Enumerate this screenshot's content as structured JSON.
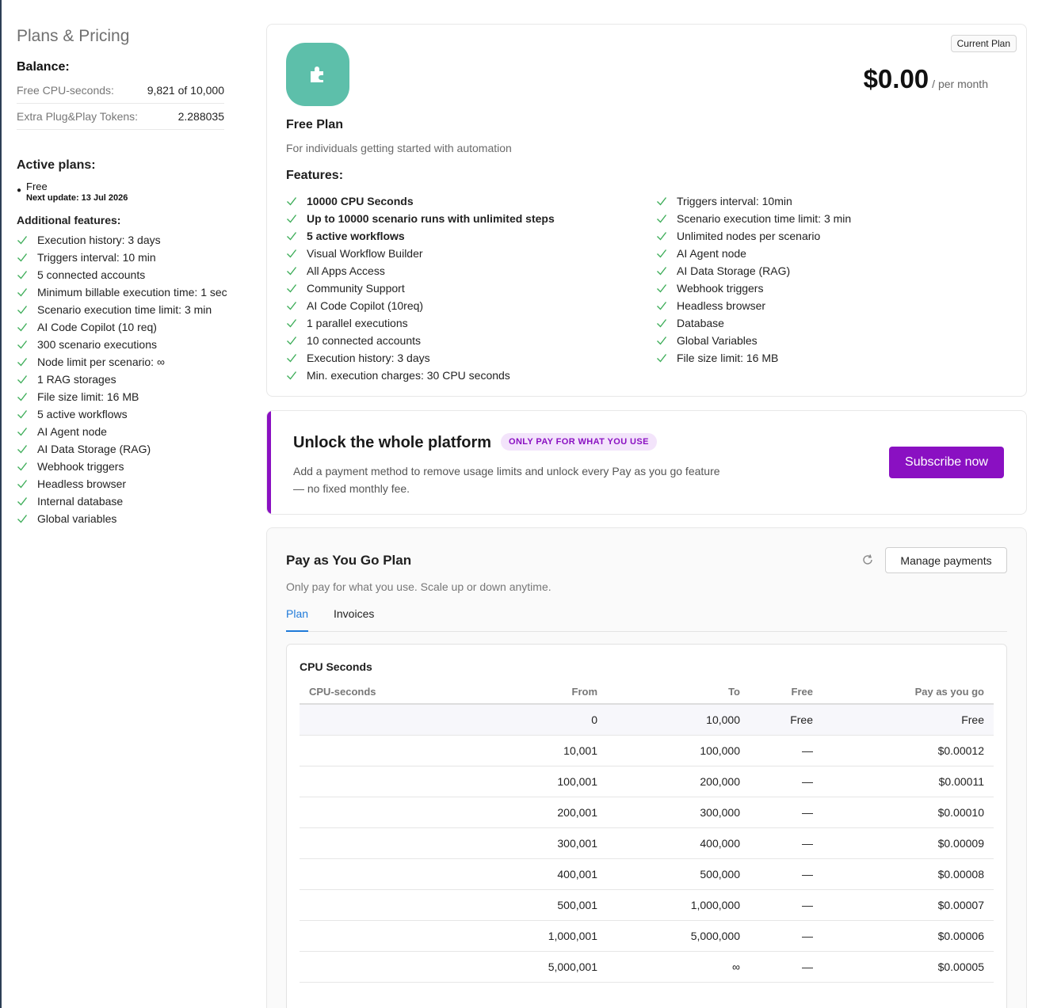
{
  "sidebar": {
    "title": "Plans & Pricing",
    "balance_heading": "Balance:",
    "balance": [
      {
        "label": "Free CPU-seconds:",
        "value": "9,821 of 10,000"
      },
      {
        "label": "Extra Plug&Play Tokens:",
        "value": "2.288035"
      }
    ],
    "active_heading": "Active plans:",
    "active_plan": {
      "name": "Free",
      "next_update": "Next update: 13 Jul 2026"
    },
    "additional_heading": "Additional features:",
    "features": [
      "Execution history: 3 days",
      "Triggers interval: 10 min",
      "5 connected accounts",
      "Minimum billable execution time: 1 sec",
      "Scenario execution time limit: 3 min",
      "AI Code Copilot (10 req)",
      "300 scenario executions",
      "Node limit per scenario: ∞",
      "1 RAG storages",
      "File size limit: 16 MB",
      "5 active workflows",
      "AI Agent node",
      "AI Data Storage (RAG)",
      "Webhook triggers",
      "Headless browser",
      "Internal database",
      "Global variables"
    ]
  },
  "free_plan": {
    "badge": "Current Plan",
    "price": "$0.00",
    "per": "/ per month",
    "name": "Free Plan",
    "description": "For individuals getting started with automation",
    "features_heading": "Features:",
    "features_left": [
      {
        "text": "10000 CPU Seconds",
        "bold": true
      },
      {
        "text": "Up to 10000 scenario runs with unlimited steps",
        "bold": true
      },
      {
        "text": "5 active workflows",
        "bold": true
      },
      {
        "text": "Visual Workflow Builder",
        "bold": false
      },
      {
        "text": "All Apps Access",
        "bold": false
      },
      {
        "text": "Community Support",
        "bold": false
      },
      {
        "text": "AI Code Copilot (10req)",
        "bold": false
      },
      {
        "text": "1 parallel executions",
        "bold": false
      },
      {
        "text": "10 connected accounts",
        "bold": false
      },
      {
        "text": "Execution history: 3 days",
        "bold": false
      },
      {
        "text": "Min. execution charges: 30 CPU seconds",
        "bold": false
      }
    ],
    "features_right": [
      "Triggers interval: 10min",
      "Scenario execution time limit: 3 min",
      "Unlimited nodes per scenario",
      "AI Agent node",
      "AI Data Storage (RAG)",
      "Webhook triggers",
      "Headless browser",
      "Database",
      "Global Variables",
      "File size limit: 16 MB"
    ],
    "colors": {
      "logo": "#5dbfaa",
      "check": "#3fae5a"
    }
  },
  "unlock": {
    "title": "Unlock the whole platform",
    "pill": "ONLY PAY FOR WHAT YOU USE",
    "description": "Add a payment method to remove usage limits and unlock every Pay as you go feature — no fixed monthly fee.",
    "button": "Subscribe now",
    "accent": "#8a10c2"
  },
  "payg": {
    "title": "Pay as You Go Plan",
    "description": "Only pay for what you use. Scale up or down anytime.",
    "manage_button": "Manage payments",
    "refresh_icon": "refresh-icon",
    "tabs": [
      "Plan",
      "Invoices"
    ],
    "active_tab": "Plan",
    "table_title": "CPU Seconds",
    "columns": [
      "CPU-seconds",
      "From",
      "To",
      "Free",
      "Pay as you go"
    ],
    "rows": [
      [
        "",
        "0",
        "10,000",
        "Free",
        "Free"
      ],
      [
        "",
        "10,001",
        "100,000",
        "—",
        "$0.00012"
      ],
      [
        "",
        "100,001",
        "200,000",
        "—",
        "$0.00011"
      ],
      [
        "",
        "200,001",
        "300,000",
        "—",
        "$0.00010"
      ],
      [
        "",
        "300,001",
        "400,000",
        "—",
        "$0.00009"
      ],
      [
        "",
        "400,001",
        "500,000",
        "—",
        "$0.00008"
      ],
      [
        "",
        "500,001",
        "1,000,000",
        "—",
        "$0.00007"
      ],
      [
        "",
        "1,000,001",
        "5,000,000",
        "—",
        "$0.00006"
      ],
      [
        "",
        "5,000,001",
        "∞",
        "—",
        "$0.00005"
      ]
    ]
  }
}
